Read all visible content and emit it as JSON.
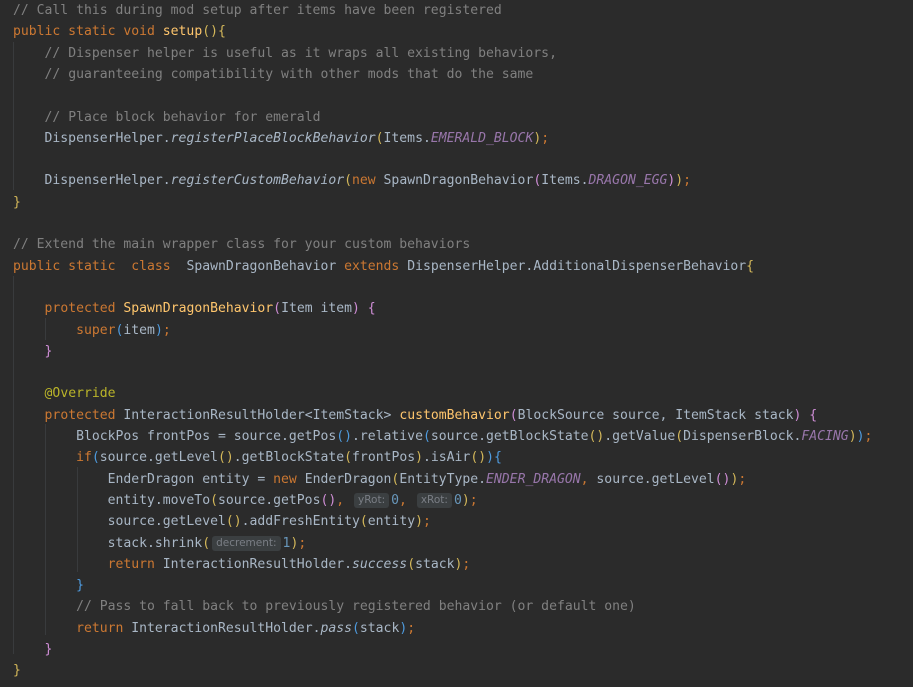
{
  "theme": {
    "background": "#2b2b2b",
    "default_text": "#a9b7c6",
    "keyword": "#cc7832",
    "comment": "#808080",
    "method_declaration": "#ffc66d",
    "static_field": "#9876aa",
    "annotation": "#bbb529",
    "number": "#6897bb",
    "inlay_hint_bg": "#3b3f41",
    "inlay_hint_text": "#7a7e85"
  },
  "editor": {
    "language": "Java",
    "lines": [
      [
        {
          "t": "cm",
          "v": "// Call this during mod setup after items have been registered"
        }
      ],
      [
        {
          "t": "kw",
          "v": "public static void "
        },
        {
          "t": "fn",
          "v": "setup"
        },
        {
          "t": "br1",
          "v": "()"
        },
        {
          "t": "br1",
          "v": "{"
        }
      ],
      [
        {
          "t": "pl",
          "v": "    "
        },
        {
          "t": "cm",
          "v": "// Dispenser helper is useful as it wraps all existing behaviors,"
        }
      ],
      [
        {
          "t": "pl",
          "v": "    "
        },
        {
          "t": "cm",
          "v": "// guaranteeing compatibility with other mods that do the same"
        }
      ],
      [],
      [
        {
          "t": "pl",
          "v": "    "
        },
        {
          "t": "cm",
          "v": "// Place block behavior for emerald"
        }
      ],
      [
        {
          "t": "pl",
          "v": "    DispenserHelper."
        },
        {
          "t": "it",
          "v": "registerPlaceBlockBehavior"
        },
        {
          "t": "br1",
          "v": "("
        },
        {
          "t": "pl",
          "v": "Items."
        },
        {
          "t": "fi",
          "v": "EMERALD_BLOCK"
        },
        {
          "t": "br1",
          "v": ")"
        },
        {
          "t": "kw",
          "v": ";"
        }
      ],
      [],
      [
        {
          "t": "pl",
          "v": "    DispenserHelper."
        },
        {
          "t": "it",
          "v": "registerCustomBehavior"
        },
        {
          "t": "br1",
          "v": "("
        },
        {
          "t": "kw",
          "v": "new "
        },
        {
          "t": "pl",
          "v": "SpawnDragonBehavior"
        },
        {
          "t": "br2",
          "v": "("
        },
        {
          "t": "pl",
          "v": "Items."
        },
        {
          "t": "fi",
          "v": "DRAGON_EGG"
        },
        {
          "t": "br2",
          "v": ")"
        },
        {
          "t": "br1",
          "v": ")"
        },
        {
          "t": "kw",
          "v": ";"
        }
      ],
      [
        {
          "t": "br1",
          "v": "}"
        }
      ],
      [],
      [
        {
          "t": "cm",
          "v": "// Extend the main wrapper class for your custom behaviors"
        }
      ],
      [
        {
          "t": "kw",
          "v": "public static  class  "
        },
        {
          "t": "pl",
          "v": "SpawnDragonBehavior "
        },
        {
          "t": "kw",
          "v": "extends "
        },
        {
          "t": "pl",
          "v": "DispenserHelper.AdditionalDispenserBehavior"
        },
        {
          "t": "br1",
          "v": "{"
        }
      ],
      [],
      [
        {
          "t": "pl",
          "v": "    "
        },
        {
          "t": "kw",
          "v": "protected "
        },
        {
          "t": "fn",
          "v": "SpawnDragonBehavior"
        },
        {
          "t": "br2",
          "v": "("
        },
        {
          "t": "pl",
          "v": "Item item"
        },
        {
          "t": "br2",
          "v": ") "
        },
        {
          "t": "br2",
          "v": "{"
        }
      ],
      [
        {
          "t": "pl",
          "v": "        "
        },
        {
          "t": "kw",
          "v": "super"
        },
        {
          "t": "br3",
          "v": "("
        },
        {
          "t": "pl",
          "v": "item"
        },
        {
          "t": "br3",
          "v": ")"
        },
        {
          "t": "kw",
          "v": ";"
        }
      ],
      [
        {
          "t": "pl",
          "v": "    "
        },
        {
          "t": "br2",
          "v": "}"
        }
      ],
      [],
      [
        {
          "t": "pl",
          "v": "    "
        },
        {
          "t": "an",
          "v": "@Override"
        }
      ],
      [
        {
          "t": "pl",
          "v": "    "
        },
        {
          "t": "kw",
          "v": "protected "
        },
        {
          "t": "pl",
          "v": "InteractionResultHolder<ItemStack> "
        },
        {
          "t": "fn",
          "v": "customBehavior"
        },
        {
          "t": "br2",
          "v": "("
        },
        {
          "t": "pl",
          "v": "BlockSource source, ItemStack stack"
        },
        {
          "t": "br2",
          "v": ") "
        },
        {
          "t": "br2",
          "v": "{"
        }
      ],
      [
        {
          "t": "pl",
          "v": "        BlockPos frontPos = source.getPos"
        },
        {
          "t": "br3",
          "v": "()"
        },
        {
          "t": "pl",
          "v": ".relative"
        },
        {
          "t": "br3",
          "v": "("
        },
        {
          "t": "pl",
          "v": "source.getBlockState"
        },
        {
          "t": "br1",
          "v": "()"
        },
        {
          "t": "pl",
          "v": ".getValue"
        },
        {
          "t": "br1",
          "v": "("
        },
        {
          "t": "pl",
          "v": "DispenserBlock."
        },
        {
          "t": "fi",
          "v": "FACING"
        },
        {
          "t": "br1",
          "v": ")"
        },
        {
          "t": "br3",
          "v": ")"
        },
        {
          "t": "kw",
          "v": ";"
        }
      ],
      [
        {
          "t": "pl",
          "v": "        "
        },
        {
          "t": "kw",
          "v": "if"
        },
        {
          "t": "br3",
          "v": "("
        },
        {
          "t": "pl",
          "v": "source.getLevel"
        },
        {
          "t": "br1",
          "v": "()"
        },
        {
          "t": "pl",
          "v": ".getBlockState"
        },
        {
          "t": "br1",
          "v": "("
        },
        {
          "t": "pl",
          "v": "frontPos"
        },
        {
          "t": "br1",
          "v": ")"
        },
        {
          "t": "pl",
          "v": ".isAir"
        },
        {
          "t": "br1",
          "v": "()"
        },
        {
          "t": "br3",
          "v": ")"
        },
        {
          "t": "br3",
          "v": "{"
        }
      ],
      [
        {
          "t": "pl",
          "v": "            EnderDragon entity = "
        },
        {
          "t": "kw",
          "v": "new "
        },
        {
          "t": "pl",
          "v": "EnderDragon"
        },
        {
          "t": "br1",
          "v": "("
        },
        {
          "t": "pl",
          "v": "EntityType."
        },
        {
          "t": "fi",
          "v": "ENDER_DRAGON"
        },
        {
          "t": "kw",
          "v": ", "
        },
        {
          "t": "pl",
          "v": "source.getLevel"
        },
        {
          "t": "br2",
          "v": "()"
        },
        {
          "t": "br1",
          "v": ")"
        },
        {
          "t": "kw",
          "v": ";"
        }
      ],
      [
        {
          "t": "pl",
          "v": "            entity.moveTo"
        },
        {
          "t": "br1",
          "v": "("
        },
        {
          "t": "pl",
          "v": "source.getPos"
        },
        {
          "t": "br2",
          "v": "()"
        },
        {
          "t": "kw",
          "v": ", "
        },
        {
          "t": "hint",
          "v": "yRot:"
        },
        {
          "t": "nu",
          "v": "0"
        },
        {
          "t": "kw",
          "v": ", "
        },
        {
          "t": "hint",
          "v": "xRot:"
        },
        {
          "t": "nu",
          "v": "0"
        },
        {
          "t": "br1",
          "v": ")"
        },
        {
          "t": "kw",
          "v": ";"
        }
      ],
      [
        {
          "t": "pl",
          "v": "            source.getLevel"
        },
        {
          "t": "br1",
          "v": "()"
        },
        {
          "t": "pl",
          "v": ".addFreshEntity"
        },
        {
          "t": "br1",
          "v": "("
        },
        {
          "t": "pl",
          "v": "entity"
        },
        {
          "t": "br1",
          "v": ")"
        },
        {
          "t": "kw",
          "v": ";"
        }
      ],
      [
        {
          "t": "pl",
          "v": "            stack.shrink"
        },
        {
          "t": "br1",
          "v": "("
        },
        {
          "t": "hint",
          "v": "decrement:"
        },
        {
          "t": "nu",
          "v": "1"
        },
        {
          "t": "br1",
          "v": ")"
        },
        {
          "t": "kw",
          "v": ";"
        }
      ],
      [
        {
          "t": "pl",
          "v": "            "
        },
        {
          "t": "kw",
          "v": "return "
        },
        {
          "t": "pl",
          "v": "InteractionResultHolder."
        },
        {
          "t": "it",
          "v": "success"
        },
        {
          "t": "br1",
          "v": "("
        },
        {
          "t": "pl",
          "v": "stack"
        },
        {
          "t": "br1",
          "v": ")"
        },
        {
          "t": "kw",
          "v": ";"
        }
      ],
      [
        {
          "t": "pl",
          "v": "        "
        },
        {
          "t": "br3",
          "v": "}"
        }
      ],
      [
        {
          "t": "pl",
          "v": "        "
        },
        {
          "t": "cm",
          "v": "// Pass to fall back to previously registered behavior (or default one)"
        }
      ],
      [
        {
          "t": "pl",
          "v": "        "
        },
        {
          "t": "kw",
          "v": "return "
        },
        {
          "t": "pl",
          "v": "InteractionResultHolder."
        },
        {
          "t": "it",
          "v": "pass"
        },
        {
          "t": "br3",
          "v": "("
        },
        {
          "t": "pl",
          "v": "stack"
        },
        {
          "t": "br3",
          "v": ")"
        },
        {
          "t": "kw",
          "v": ";"
        }
      ],
      [
        {
          "t": "pl",
          "v": "    "
        },
        {
          "t": "br2",
          "v": "}"
        }
      ],
      [
        {
          "t": "br1",
          "v": "}"
        }
      ]
    ]
  }
}
